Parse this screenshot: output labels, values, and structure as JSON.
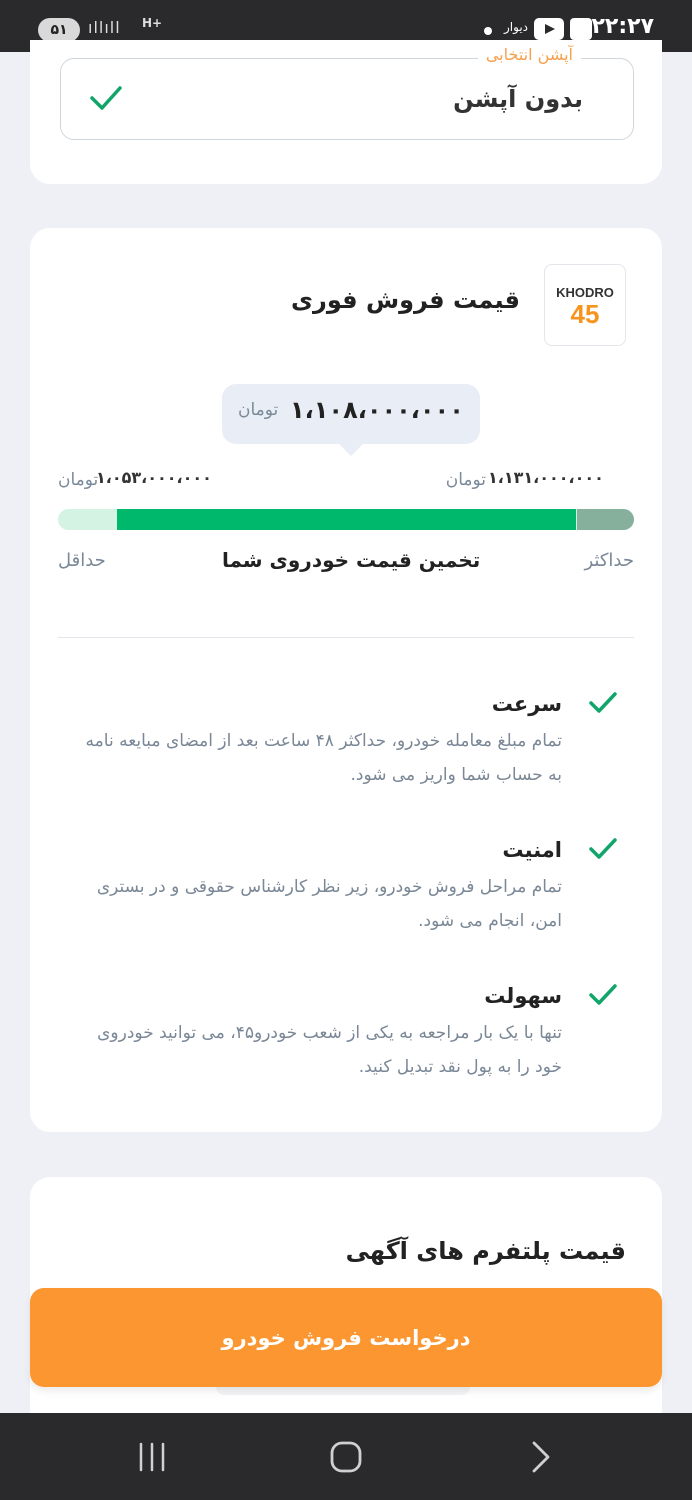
{
  "status_bar": {
    "time": "۲۲:۲۷",
    "app_label": "دیوار",
    "battery": "۵۱",
    "network": "H+"
  },
  "option_card": {
    "legend": "آپشن انتخابی",
    "value": "بدون آپشن"
  },
  "instant_sale": {
    "logo_text": "KHODRO",
    "logo_number": "45",
    "title": "قیمت فروش فوری",
    "estimate": {
      "price": "۱،۱۰۸،۰۰۰،۰۰۰",
      "unit": "تومان"
    },
    "max": {
      "price": "۱،۱۳۱،۰۰۰،۰۰۰",
      "unit": "تومان",
      "label": "حداکثر"
    },
    "min": {
      "price": "۱،۰۵۳،۰۰۰،۰۰۰",
      "unit": "تومان",
      "label": "حداقل"
    },
    "range_caption": "تخمین قیمت خودروی شما",
    "range_values": {
      "min": 1053000000,
      "max": 1131000000,
      "estimate": 1108000000
    },
    "features": [
      {
        "title": "سرعت",
        "description": "تمام مبلغ معامله خودرو، حداکثر ۴۸ ساعت بعد از امضای مبایعه نامه به حساب شما واریز می شود."
      },
      {
        "title": "امنیت",
        "description": "تمام مراحل فروش خودرو، زیر نظر کارشناس حقوقی و در بستری امن، انجام می شود."
      },
      {
        "title": "سهولت",
        "description": "تنها با یک بار مراجعه به یکی از شعب خودرو۴۵، می توانید خودروی خود را به پول نقد تبدیل کنید."
      }
    ]
  },
  "platforms": {
    "title": "قیمت پلتفرم های آگهی"
  },
  "cta": {
    "label": "درخواست فروش خودرو"
  },
  "colors": {
    "accent_orange": "#fb9630",
    "range_green": "#00b86b",
    "check_green": "#12a56a"
  },
  "icons": {
    "check": "check-icon",
    "nav_recents": "recents-icon",
    "nav_home": "home-icon",
    "nav_back": "back-icon"
  }
}
